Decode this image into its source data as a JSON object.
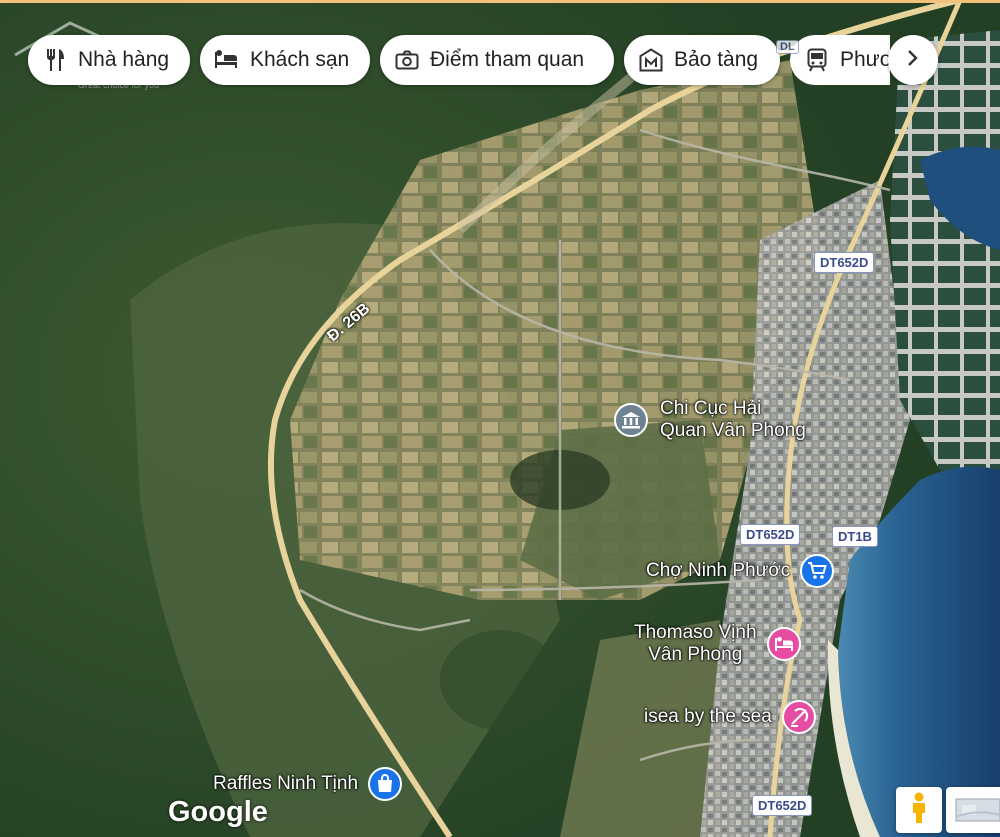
{
  "chips": [
    {
      "label": "Nhà hàng",
      "icon": "restaurant-icon"
    },
    {
      "label": "Khách sạn",
      "icon": "hotel-icon"
    },
    {
      "label": "Điểm tham quan",
      "icon": "camera-icon"
    },
    {
      "label": "Bảo tàng",
      "icon": "museum-icon"
    },
    {
      "label": "Phươ",
      "icon": "transit-icon"
    }
  ],
  "ghost_logo": {
    "tagline": "Great choice for you"
  },
  "road_names": {
    "main": "Đ. 26B"
  },
  "road_labels": {
    "dt652d_top": "DT652D",
    "dt652d_mid": "DT652D",
    "dt1b": "DT1B",
    "dt652d_bottom": "DT652D",
    "partial_top": "DL"
  },
  "pois": {
    "customs": {
      "line1": "Chi Cục Hải",
      "line2": "Quan Vân Phong",
      "icon": "government-icon"
    },
    "market": {
      "label": "Chợ Ninh Phước",
      "icon": "shopping-cart-icon"
    },
    "thomaso": {
      "line1": "Thomaso Vịnh",
      "line2": "Vân Phong",
      "icon": "hotel-icon"
    },
    "isea": {
      "label": "isea by the sea",
      "icon": "leisure-icon"
    },
    "raffles": {
      "label": "Raffles Ninh Tịnh",
      "icon": "shopping-bag-icon"
    }
  },
  "branding": {
    "google": "Google"
  },
  "colors": {
    "hotel_pin": "#e64ca2",
    "shop_pin": "#1a73e8",
    "gov_pin": "#6f8291",
    "road": "#e8d49a",
    "sea": "#1f4d7a"
  }
}
